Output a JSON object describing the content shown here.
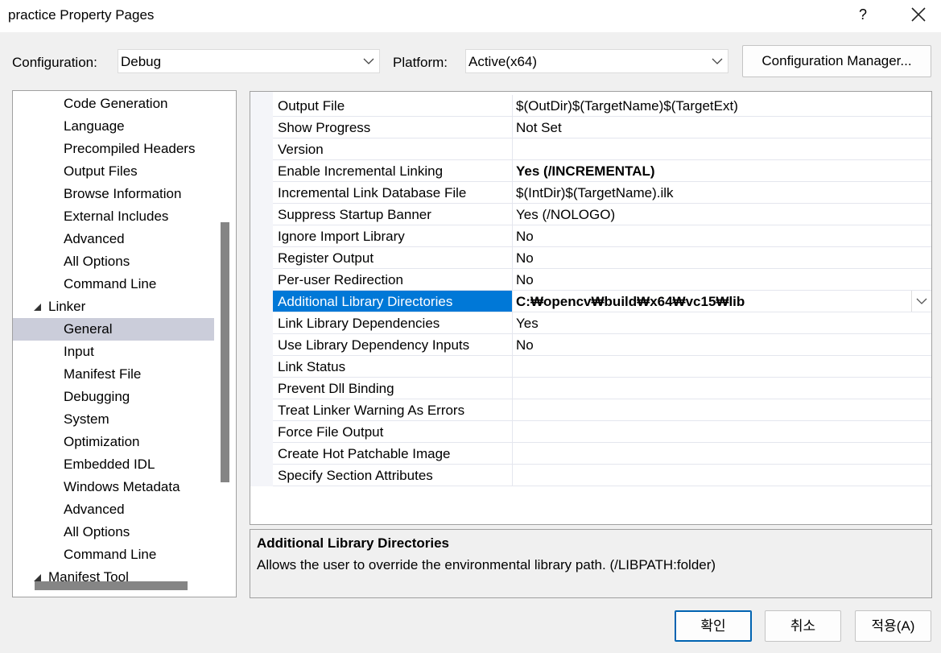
{
  "window": {
    "title": "practice Property Pages",
    "help_label": "?"
  },
  "toolbar": {
    "configuration_label": "Configuration:",
    "configuration_value": "Debug",
    "platform_label": "Platform:",
    "platform_value": "Active(x64)",
    "config_manager_label": "Configuration Manager..."
  },
  "tree": {
    "items": [
      {
        "label": "Code Generation"
      },
      {
        "label": "Language"
      },
      {
        "label": "Precompiled Headers"
      },
      {
        "label": "Output Files"
      },
      {
        "label": "Browse Information"
      },
      {
        "label": "External Includes"
      },
      {
        "label": "Advanced"
      },
      {
        "label": "All Options"
      },
      {
        "label": "Command Line"
      },
      {
        "label": "Linker"
      },
      {
        "label": "General"
      },
      {
        "label": "Input"
      },
      {
        "label": "Manifest File"
      },
      {
        "label": "Debugging"
      },
      {
        "label": "System"
      },
      {
        "label": "Optimization"
      },
      {
        "label": "Embedded IDL"
      },
      {
        "label": "Windows Metadata"
      },
      {
        "label": "Advanced"
      },
      {
        "label": "All Options"
      },
      {
        "label": "Command Line"
      },
      {
        "label": "Manifest Tool"
      }
    ],
    "selected": "General"
  },
  "properties": {
    "rows": [
      {
        "name": "Output File",
        "value": "$(OutDir)$(TargetName)$(TargetExt)"
      },
      {
        "name": "Show Progress",
        "value": "Not Set"
      },
      {
        "name": "Version",
        "value": ""
      },
      {
        "name": "Enable Incremental Linking",
        "value": "Yes (/INCREMENTAL)"
      },
      {
        "name": "Incremental Link Database File",
        "value": "$(IntDir)$(TargetName).ilk"
      },
      {
        "name": "Suppress Startup Banner",
        "value": "Yes (/NOLOGO)"
      },
      {
        "name": "Ignore Import Library",
        "value": "No"
      },
      {
        "name": "Register Output",
        "value": "No"
      },
      {
        "name": "Per-user Redirection",
        "value": "No"
      },
      {
        "name": "Additional Library Directories",
        "value": "C:₩opencv₩build₩x64₩vc15₩lib"
      },
      {
        "name": "Link Library Dependencies",
        "value": "Yes"
      },
      {
        "name": "Use Library Dependency Inputs",
        "value": "No"
      },
      {
        "name": "Link Status",
        "value": ""
      },
      {
        "name": "Prevent Dll Binding",
        "value": ""
      },
      {
        "name": "Treat Linker Warning As Errors",
        "value": ""
      },
      {
        "name": "Force File Output",
        "value": ""
      },
      {
        "name": "Create Hot Patchable Image",
        "value": ""
      },
      {
        "name": "Specify Section Attributes",
        "value": ""
      }
    ]
  },
  "description": {
    "title": "Additional Library Directories",
    "text": "Allows the user to override the environmental library path. (/LIBPATH:folder)"
  },
  "footer": {
    "ok_label": "확인",
    "cancel_label": "취소",
    "apply_label": "적용(A)"
  },
  "colors": {
    "selection": "#0078d7",
    "tree_selection": "#cbcdda",
    "background": "#f0f0f0"
  }
}
